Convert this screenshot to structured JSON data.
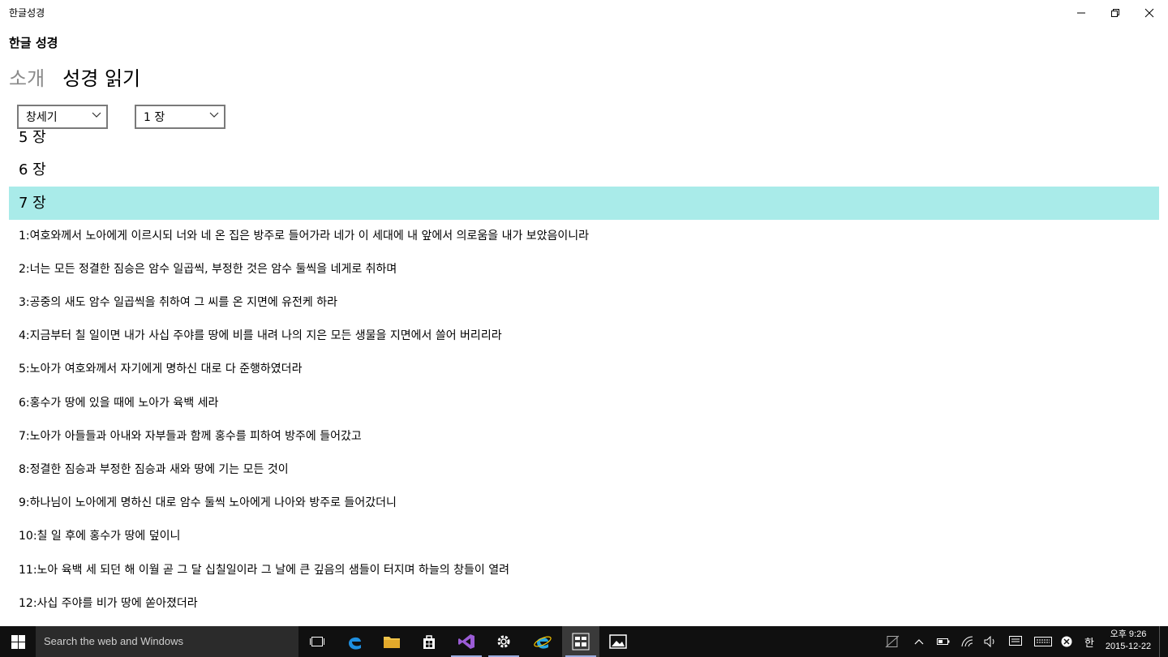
{
  "window": {
    "title": "한글성경"
  },
  "app": {
    "header": "한글 성경"
  },
  "pivot": {
    "tabs": [
      {
        "label": "소개"
      },
      {
        "label": "성경 읽기"
      }
    ]
  },
  "selectors": {
    "book": "창세기",
    "chapter": "1 장"
  },
  "chapters": {
    "items": [
      "5 장",
      "6 장",
      "7 장"
    ],
    "selected": "7 장"
  },
  "verses": [
    "1:여호와께서 노아에게 이르시되 너와 네 온 집은 방주로 들어가라 네가 이 세대에 내 앞에서 의로움을 내가 보았음이니라",
    "2:너는 모든 정결한 짐승은 암수 일곱씩, 부정한 것은 암수 둘씩을 네게로 취하며",
    "3:공중의 새도 암수 일곱씩을 취하여 그 씨를 온 지면에 유전케 하라",
    "4:지금부터 칠 일이면 내가 사십 주야를 땅에 비를 내려 나의 지은 모든 생물을 지면에서 쓸어 버리리라",
    "5:노아가 여호와께서 자기에게 명하신 대로 다 준행하였더라",
    "6:홍수가 땅에 있을 때에 노아가 육백 세라",
    "7:노아가 아들들과 아내와 자부들과 함께 홍수를 피하여 방주에 들어갔고",
    "8:정결한 짐승과 부정한 짐승과 새와 땅에 기는 모든 것이",
    "9:하나님이 노아에게 명하신 대로 암수 둘씩 노아에게 나아와 방주로 들어갔더니",
    "10:칠 일 후에 홍수가 땅에 덮이니",
    "11:노아 육백 세 되던 해 이월 곧 그 달 십칠일이라 그 날에 큰 깊음의 샘들이 터지며 하늘의 창들이 열려",
    "12:사십 주야를 비가 땅에 쏟아졌더라"
  ],
  "taskbar": {
    "search_placeholder": "Search the web and Windows",
    "ime": "한",
    "app_label": "한글 성경",
    "clock_time": "오후 9:26",
    "clock_date": "2015-12-22"
  },
  "colors": {
    "selected_row": "#a9ebe9",
    "taskbar": "#101010"
  }
}
